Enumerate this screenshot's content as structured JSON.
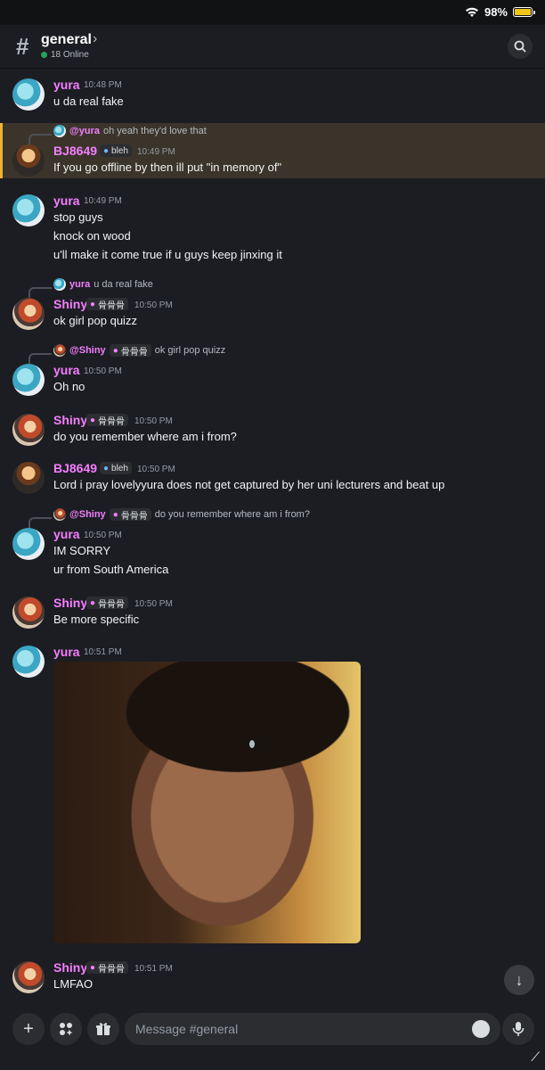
{
  "status": {
    "battery": "98%"
  },
  "header": {
    "channel": "general",
    "online": "18 Online"
  },
  "messages": [
    {
      "author": "yura",
      "time": "10:48 PM",
      "lines": [
        "u da real fake"
      ]
    },
    {
      "reply_to": "@yura",
      "reply_text": "oh yeah they'd love that",
      "author": "BJ8649",
      "badge": "bleh",
      "time": "10:49 PM",
      "lines": [
        "If you go offline by then ill put \"in memory of\""
      ]
    },
    {
      "author": "yura",
      "time": "10:49 PM",
      "lines": [
        "stop guys",
        "knock on wood",
        "u'll make it come true if u guys keep jinxing it"
      ]
    },
    {
      "reply_to": "yura",
      "reply_text": "u da real fake",
      "author": "Shiny",
      "badge": "骨骨骨",
      "time": "10:50 PM",
      "lines": [
        "ok girl pop quizz"
      ]
    },
    {
      "reply_to": "@Shiny",
      "reply_badge": "骨骨骨",
      "reply_text": "ok girl pop quizz",
      "author": "yura",
      "time": "10:50 PM",
      "lines": [
        "Oh no"
      ]
    },
    {
      "author": "Shiny",
      "badge": "骨骨骨",
      "time": "10:50 PM",
      "lines": [
        "do you remember where am i from?"
      ]
    },
    {
      "author": "BJ8649",
      "badge": "bleh",
      "time": "10:50 PM",
      "lines": [
        "Lord i pray lovelyyura does not get captured by her uni lecturers and beat up"
      ]
    },
    {
      "reply_to": "@Shiny",
      "reply_badge": "骨骨骨",
      "reply_text": "do you remember where am i from?",
      "author": "yura",
      "time": "10:50 PM",
      "lines": [
        "IM SORRY",
        "ur from South America"
      ]
    },
    {
      "author": "Shiny",
      "badge": "骨骨骨",
      "time": "10:50 PM",
      "lines": [
        "Be more specific"
      ]
    },
    {
      "author": "yura",
      "time": "10:51 PM",
      "lines": []
    },
    {
      "author": "Shiny",
      "badge": "骨骨骨",
      "time": "10:51 PM",
      "lines": [
        "LMFAO"
      ]
    }
  ],
  "composer": {
    "placeholder": "Message #general"
  },
  "colors": {
    "accent": "#f47fff",
    "highlight": "#f0b232",
    "online": "#23a55a"
  }
}
